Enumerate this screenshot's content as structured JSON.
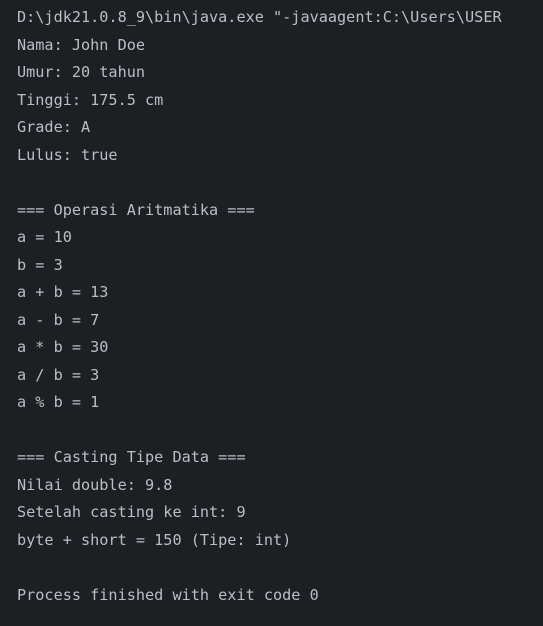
{
  "console": {
    "command_line": "D:\\jdk21.0.8_9\\bin\\java.exe \"-javaagent:C:\\Users\\USER",
    "lines": [
      "Nama: John Doe",
      "Umur: 20 tahun",
      "Tinggi: 175.5 cm",
      "Grade: A",
      "Lulus: true",
      "",
      "=== Operasi Aritmatika ===",
      "a = 10",
      "b = 3",
      "a + b = 13",
      "a - b = 7",
      "a * b = 30",
      "a / b = 3",
      "a % b = 1",
      "",
      "=== Casting Tipe Data ===",
      "Nilai double: 9.8",
      "Setelah casting ke int: 9",
      "byte + short = 150 (Tipe: int)",
      "",
      "Process finished with exit code 0"
    ]
  },
  "colors": {
    "background": "#1e1f22",
    "text": "#bcbec4"
  }
}
